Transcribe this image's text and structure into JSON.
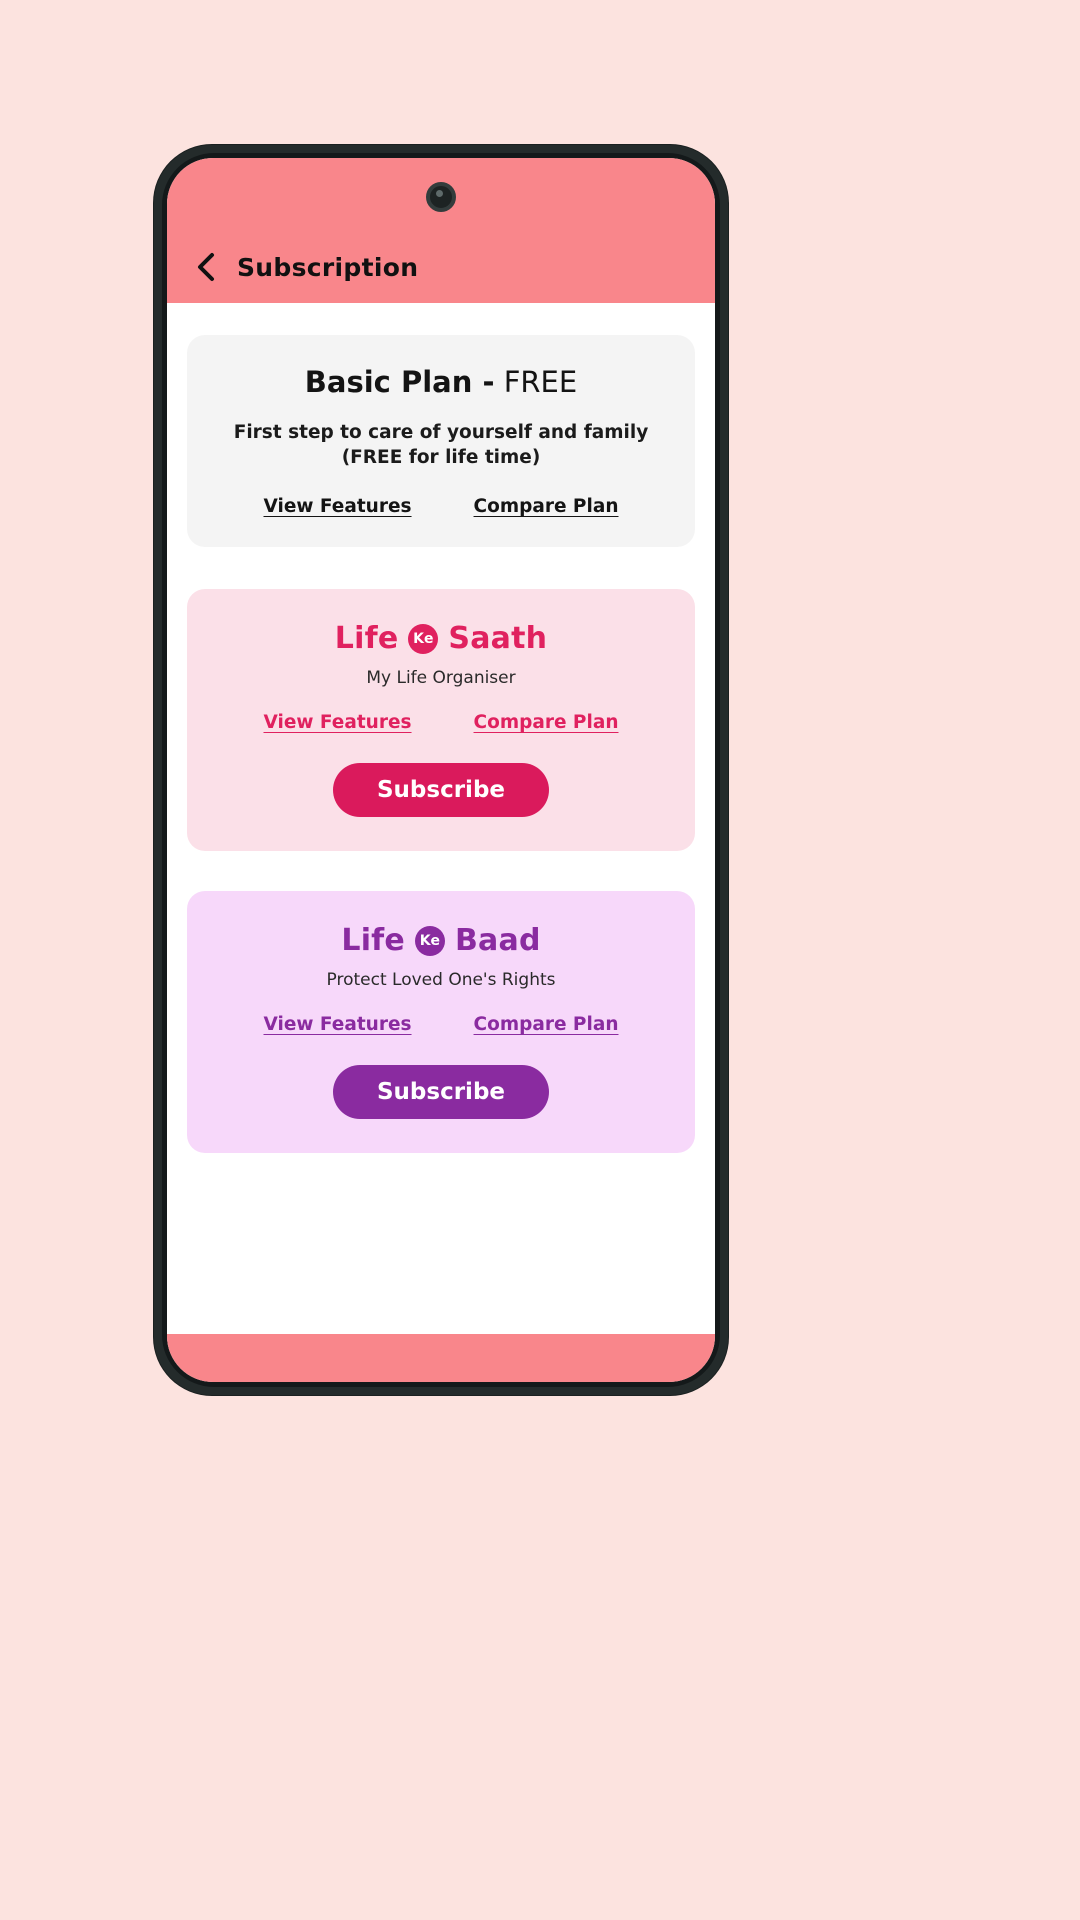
{
  "app": {
    "header": {
      "title": "Subscription",
      "back_icon": "chevron-left-icon",
      "background_color": "#F9868B"
    },
    "bottom_bar_color": "#F9868B"
  },
  "plans": [
    {
      "id": "basic",
      "title_strong": "Basic Plan -",
      "title_light": "FREE",
      "description": "First step to care of yourself and family (FREE for life time)",
      "links": [
        {
          "label": "View Features"
        },
        {
          "label": "Compare Plan"
        }
      ],
      "card_color": "#F4F4F4",
      "text_color": "#141414",
      "has_subscribe": false
    },
    {
      "id": "saath",
      "brand_first": "Life",
      "brand_badge": "Ke",
      "brand_last": "Saath",
      "tagline": "My Life Organiser",
      "links": [
        {
          "label": "View Features"
        },
        {
          "label": "Compare Plan"
        }
      ],
      "subscribe_label": "Subscribe",
      "card_color": "#FBE0E8",
      "accent_color": "#E0215F",
      "button_color": "#DA1A5C"
    },
    {
      "id": "baad",
      "brand_first": "Life",
      "brand_badge": "Ke",
      "brand_last": "Baad",
      "tagline": "Protect Loved One's Rights",
      "links": [
        {
          "label": "View Features"
        },
        {
          "label": "Compare Plan"
        }
      ],
      "subscribe_label": "Subscribe",
      "card_color": "#F7D8FA",
      "accent_color": "#8A2BA0",
      "button_color": "#8A2BA0"
    }
  ]
}
